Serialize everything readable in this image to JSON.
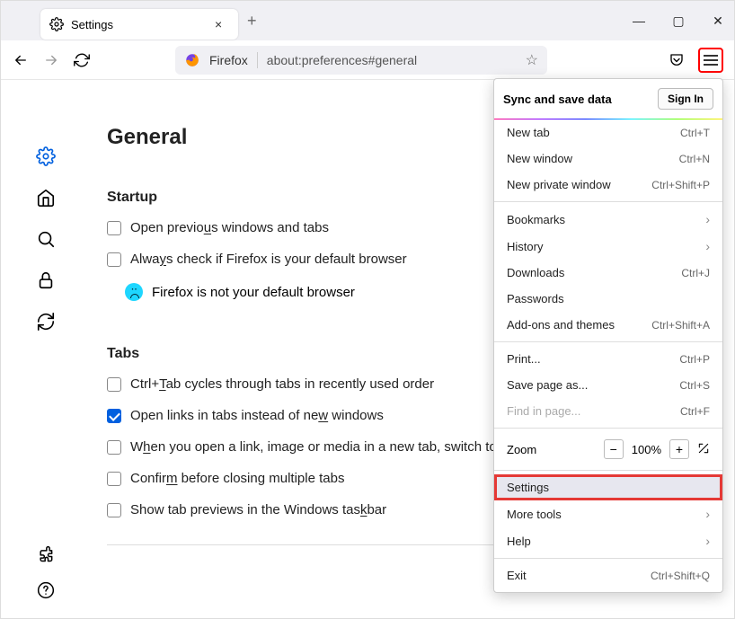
{
  "tab": {
    "title": "Settings"
  },
  "url": {
    "prefix": "Firefox",
    "path": "about:preferences#general"
  },
  "page": {
    "title": "General",
    "startup": {
      "heading": "Startup",
      "open_previous": "Open previous windows and tabs",
      "always_check": "Always check if Firefox is your default browser",
      "not_default": "Firefox is not your default browser"
    },
    "tabs": {
      "heading": "Tabs",
      "ctrl_tab": "Ctrl+Tab cycles through tabs in recently used order",
      "open_links": "Open links in tabs instead of new windows",
      "when_open": "When you open a link, image or media in a new tab, switch to it",
      "confirm": "Confirm before closing multiple tabs",
      "previews": "Show tab previews in the Windows taskbar"
    }
  },
  "menu": {
    "sync_title": "Sync and save data",
    "signin": "Sign In",
    "new_tab": "New tab",
    "new_tab_key": "Ctrl+T",
    "new_win": "New window",
    "new_win_key": "Ctrl+N",
    "new_priv": "New private window",
    "new_priv_key": "Ctrl+Shift+P",
    "bookmarks": "Bookmarks",
    "history": "History",
    "downloads": "Downloads",
    "downloads_key": "Ctrl+J",
    "passwords": "Passwords",
    "addons": "Add-ons and themes",
    "addons_key": "Ctrl+Shift+A",
    "print": "Print...",
    "print_key": "Ctrl+P",
    "save_as": "Save page as...",
    "save_key": "Ctrl+S",
    "find": "Find in page...",
    "find_key": "Ctrl+F",
    "zoom": "Zoom",
    "zoom_val": "100%",
    "settings": "Settings",
    "more_tools": "More tools",
    "help": "Help",
    "exit": "Exit",
    "exit_key": "Ctrl+Shift+Q"
  }
}
